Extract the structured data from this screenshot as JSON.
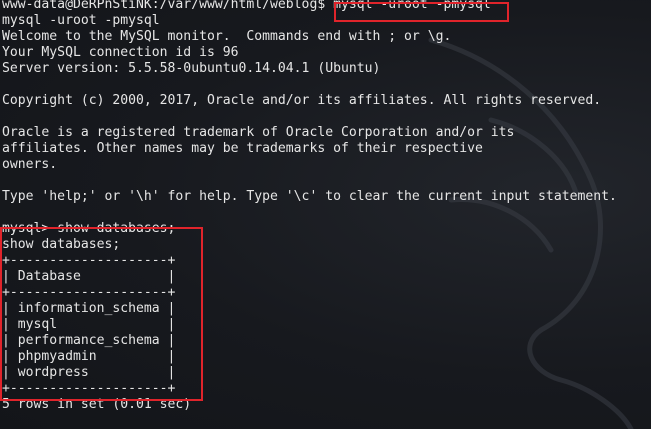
{
  "terminal": {
    "lines": [
      "www-data@DeRPnStiNK:/var/www/html/weblog$ mysql -uroot -pmysql",
      "mysql -uroot -pmysql",
      "Welcome to the MySQL monitor.  Commands end with ; or \\g.",
      "Your MySQL connection id is 96",
      "Server version: 5.5.58-0ubuntu0.14.04.1 (Ubuntu)",
      "",
      "Copyright (c) 2000, 2017, Oracle and/or its affiliates. All rights reserved.",
      "",
      "Oracle is a registered trademark of Oracle Corporation and/or its",
      "affiliates. Other names may be trademarks of their respective",
      "owners.",
      "",
      "Type 'help;' or '\\h' for help. Type '\\c' to clear the current input statement.",
      "",
      "mysql> show databases;",
      "show databases;",
      "+--------------------+",
      "| Database           |",
      "+--------------------+",
      "| information_schema |",
      "| mysql              |",
      "| performance_schema |",
      "| phpmyadmin         |",
      "| wordpress          |",
      "+--------------------+",
      "5 rows in set (0.01 sec)"
    ]
  },
  "colors": {
    "background": "#17191e",
    "text": "#e6e6e6",
    "highlight": "#e0242b"
  }
}
